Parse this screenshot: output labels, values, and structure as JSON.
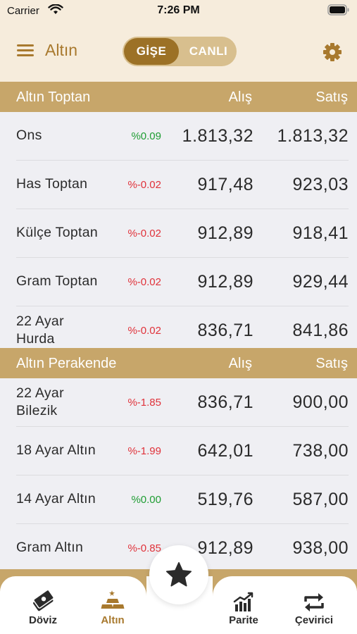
{
  "status_bar": {
    "carrier": "Carrier",
    "time": "7:26 PM"
  },
  "header": {
    "title": "Altın",
    "segments": [
      "GİŞE",
      "CANLI"
    ],
    "active_segment": "GİŞE",
    "accent_color": "#a8792e"
  },
  "wholesale": {
    "title": "Altın Toptan",
    "col_buy": "Alış",
    "col_sell": "Satış",
    "rows": [
      {
        "name": "Ons",
        "change": "%0.09",
        "direction": "up",
        "buy": "1.813,32",
        "sell": "1.813,32"
      },
      {
        "name": "Has Toptan",
        "change": "%-0.02",
        "direction": "down",
        "buy": "917,48",
        "sell": "923,03"
      },
      {
        "name": "Külçe Toptan",
        "change": "%-0.02",
        "direction": "down",
        "buy": "912,89",
        "sell": "918,41"
      },
      {
        "name": "Gram Toptan",
        "change": "%-0.02",
        "direction": "down",
        "buy": "912,89",
        "sell": "929,44"
      },
      {
        "name": "22 Ayar Hurda",
        "change": "%-0.02",
        "direction": "down",
        "buy": "836,71",
        "sell": "841,86"
      }
    ]
  },
  "retail": {
    "title": "Altın Perakende",
    "col_buy": "Alış",
    "col_sell": "Satış",
    "rows": [
      {
        "name": "22 Ayar Bilezik",
        "change": "%-1.85",
        "direction": "down",
        "buy": "836,71",
        "sell": "900,00"
      },
      {
        "name": "18 Ayar Altın",
        "change": "%-1.99",
        "direction": "down",
        "buy": "642,01",
        "sell": "738,00"
      },
      {
        "name": "14 Ayar Altın",
        "change": "%0.00",
        "direction": "up",
        "buy": "519,76",
        "sell": "587,00"
      },
      {
        "name": "Gram Altın",
        "change": "%-0.85",
        "direction": "down",
        "buy": "912,89",
        "sell": "938,00"
      }
    ]
  },
  "tabs": [
    {
      "label": "Döviz",
      "icon": "banknotes-icon"
    },
    {
      "label": "Altın",
      "icon": "gold-bars-icon",
      "active": true
    },
    {
      "label": "Parite",
      "icon": "bar-chart-icon"
    },
    {
      "label": "Çevirici",
      "icon": "swap-arrows-icon"
    }
  ],
  "fab": {
    "icon": "star-icon"
  },
  "colors": {
    "up": "#1f9d33",
    "down": "#e0323a",
    "section": "#c7a66a",
    "background": "#f6ecdc"
  }
}
